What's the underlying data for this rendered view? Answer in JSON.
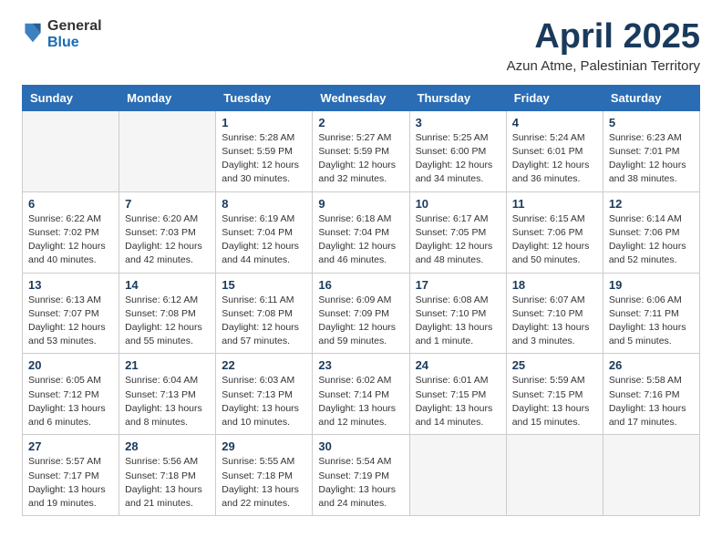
{
  "header": {
    "logo_general": "General",
    "logo_blue": "Blue",
    "month_title": "April 2025",
    "location": "Azun Atme, Palestinian Territory"
  },
  "calendar": {
    "days_of_week": [
      "Sunday",
      "Monday",
      "Tuesday",
      "Wednesday",
      "Thursday",
      "Friday",
      "Saturday"
    ],
    "weeks": [
      [
        {
          "day": "",
          "info": ""
        },
        {
          "day": "",
          "info": ""
        },
        {
          "day": "1",
          "info": "Sunrise: 5:28 AM\nSunset: 5:59 PM\nDaylight: 12 hours\nand 30 minutes."
        },
        {
          "day": "2",
          "info": "Sunrise: 5:27 AM\nSunset: 5:59 PM\nDaylight: 12 hours\nand 32 minutes."
        },
        {
          "day": "3",
          "info": "Sunrise: 5:25 AM\nSunset: 6:00 PM\nDaylight: 12 hours\nand 34 minutes."
        },
        {
          "day": "4",
          "info": "Sunrise: 5:24 AM\nSunset: 6:01 PM\nDaylight: 12 hours\nand 36 minutes."
        },
        {
          "day": "5",
          "info": "Sunrise: 6:23 AM\nSunset: 7:01 PM\nDaylight: 12 hours\nand 38 minutes."
        }
      ],
      [
        {
          "day": "6",
          "info": "Sunrise: 6:22 AM\nSunset: 7:02 PM\nDaylight: 12 hours\nand 40 minutes."
        },
        {
          "day": "7",
          "info": "Sunrise: 6:20 AM\nSunset: 7:03 PM\nDaylight: 12 hours\nand 42 minutes."
        },
        {
          "day": "8",
          "info": "Sunrise: 6:19 AM\nSunset: 7:04 PM\nDaylight: 12 hours\nand 44 minutes."
        },
        {
          "day": "9",
          "info": "Sunrise: 6:18 AM\nSunset: 7:04 PM\nDaylight: 12 hours\nand 46 minutes."
        },
        {
          "day": "10",
          "info": "Sunrise: 6:17 AM\nSunset: 7:05 PM\nDaylight: 12 hours\nand 48 minutes."
        },
        {
          "day": "11",
          "info": "Sunrise: 6:15 AM\nSunset: 7:06 PM\nDaylight: 12 hours\nand 50 minutes."
        },
        {
          "day": "12",
          "info": "Sunrise: 6:14 AM\nSunset: 7:06 PM\nDaylight: 12 hours\nand 52 minutes."
        }
      ],
      [
        {
          "day": "13",
          "info": "Sunrise: 6:13 AM\nSunset: 7:07 PM\nDaylight: 12 hours\nand 53 minutes."
        },
        {
          "day": "14",
          "info": "Sunrise: 6:12 AM\nSunset: 7:08 PM\nDaylight: 12 hours\nand 55 minutes."
        },
        {
          "day": "15",
          "info": "Sunrise: 6:11 AM\nSunset: 7:08 PM\nDaylight: 12 hours\nand 57 minutes."
        },
        {
          "day": "16",
          "info": "Sunrise: 6:09 AM\nSunset: 7:09 PM\nDaylight: 12 hours\nand 59 minutes."
        },
        {
          "day": "17",
          "info": "Sunrise: 6:08 AM\nSunset: 7:10 PM\nDaylight: 13 hours\nand 1 minute."
        },
        {
          "day": "18",
          "info": "Sunrise: 6:07 AM\nSunset: 7:10 PM\nDaylight: 13 hours\nand 3 minutes."
        },
        {
          "day": "19",
          "info": "Sunrise: 6:06 AM\nSunset: 7:11 PM\nDaylight: 13 hours\nand 5 minutes."
        }
      ],
      [
        {
          "day": "20",
          "info": "Sunrise: 6:05 AM\nSunset: 7:12 PM\nDaylight: 13 hours\nand 6 minutes."
        },
        {
          "day": "21",
          "info": "Sunrise: 6:04 AM\nSunset: 7:13 PM\nDaylight: 13 hours\nand 8 minutes."
        },
        {
          "day": "22",
          "info": "Sunrise: 6:03 AM\nSunset: 7:13 PM\nDaylight: 13 hours\nand 10 minutes."
        },
        {
          "day": "23",
          "info": "Sunrise: 6:02 AM\nSunset: 7:14 PM\nDaylight: 13 hours\nand 12 minutes."
        },
        {
          "day": "24",
          "info": "Sunrise: 6:01 AM\nSunset: 7:15 PM\nDaylight: 13 hours\nand 14 minutes."
        },
        {
          "day": "25",
          "info": "Sunrise: 5:59 AM\nSunset: 7:15 PM\nDaylight: 13 hours\nand 15 minutes."
        },
        {
          "day": "26",
          "info": "Sunrise: 5:58 AM\nSunset: 7:16 PM\nDaylight: 13 hours\nand 17 minutes."
        }
      ],
      [
        {
          "day": "27",
          "info": "Sunrise: 5:57 AM\nSunset: 7:17 PM\nDaylight: 13 hours\nand 19 minutes."
        },
        {
          "day": "28",
          "info": "Sunrise: 5:56 AM\nSunset: 7:18 PM\nDaylight: 13 hours\nand 21 minutes."
        },
        {
          "day": "29",
          "info": "Sunrise: 5:55 AM\nSunset: 7:18 PM\nDaylight: 13 hours\nand 22 minutes."
        },
        {
          "day": "30",
          "info": "Sunrise: 5:54 AM\nSunset: 7:19 PM\nDaylight: 13 hours\nand 24 minutes."
        },
        {
          "day": "",
          "info": ""
        },
        {
          "day": "",
          "info": ""
        },
        {
          "day": "",
          "info": ""
        }
      ]
    ]
  }
}
